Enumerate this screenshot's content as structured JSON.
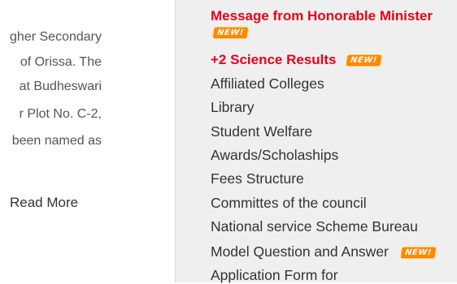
{
  "about": {
    "lines": [
      "gher Secondary",
      "of  Orissa.  The",
      "at  Budheswari",
      "r  Plot  No.  C-2,",
      "been  named  as"
    ],
    "read_more": "Read More"
  },
  "links": {
    "items": [
      {
        "label": "Message from Honorable Minister",
        "highlight": true,
        "new": true
      },
      {
        "label": "+2 Science Results",
        "highlight": true,
        "new": true
      },
      {
        "label": "Affiliated Colleges",
        "highlight": false,
        "new": false
      },
      {
        "label": "Library",
        "highlight": false,
        "new": false
      },
      {
        "label": "Student Welfare",
        "highlight": false,
        "new": false
      },
      {
        "label": "Awards/Scholaships",
        "highlight": false,
        "new": false
      },
      {
        "label": "Fees Structure",
        "highlight": false,
        "new": false
      },
      {
        "label": "Committes of the council",
        "highlight": false,
        "new": false
      },
      {
        "label": "National service Scheme Bureau",
        "highlight": false,
        "new": false
      },
      {
        "label": "Model Question and Answer",
        "highlight": false,
        "new": true
      },
      {
        "label": "Application Form for",
        "highlight": false,
        "new": false
      }
    ],
    "new_badge": "NEW!"
  },
  "colors": {
    "highlight": "#e8001b",
    "link": "#333333",
    "panel_bg": "#efefef",
    "badge": "#ff8a00"
  }
}
